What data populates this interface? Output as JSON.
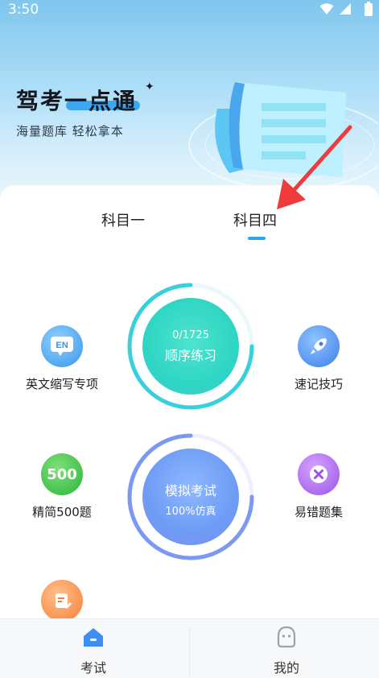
{
  "status_bar": {
    "time": "3:50"
  },
  "hero": {
    "title": "驾考一点通",
    "subtitle": "海量题库 轻松拿本"
  },
  "tabs": [
    {
      "label": "科目一"
    },
    {
      "label": "科目四"
    }
  ],
  "features": {
    "english": {
      "icon": "en-icon",
      "badge": "EN",
      "label": "英文缩写专项"
    },
    "tips": {
      "icon": "rocket-icon",
      "label": "速记技巧"
    },
    "simplified": {
      "icon": "500-icon",
      "badge": "500",
      "label": "精简500题"
    },
    "mistakes": {
      "icon": "x-icon",
      "label": "易错题集"
    },
    "notes": {
      "icon": "note-icon",
      "label": ""
    }
  },
  "practice": {
    "progress_text": "0/1725",
    "title": "顺序练习",
    "progress": 0
  },
  "exam": {
    "title": "模拟考试",
    "subtitle": "100%仿真"
  },
  "bottom_nav": [
    {
      "label": "考试",
      "icon": "home-icon"
    },
    {
      "label": "我的",
      "icon": "profile-icon"
    }
  ],
  "colors": {
    "accent": "#2aa4f0",
    "seq_circle": "#2fd6c4",
    "exam_circle": "#6e9cf5",
    "arrow": "#ee3b3b"
  }
}
